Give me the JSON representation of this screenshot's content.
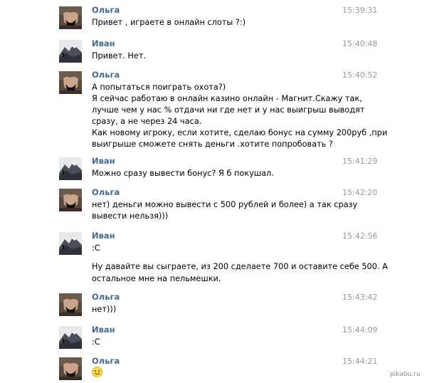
{
  "messages": [
    {
      "author": "Ольга",
      "time": "15:39:31",
      "lines": [
        "Привет , играете в онлайн слоты ?:)"
      ]
    },
    {
      "author": "Иван",
      "time": "15:40:48",
      "lines": [
        "Привет. Нет."
      ]
    },
    {
      "author": "Ольга",
      "time": "15:40:52",
      "lines": [
        "А попытаться поиграть охота?)",
        "Я сейчас работаю в онлайн казино онлайн - Магнит.Скажу так,",
        "лучше чем у нас % отдачи ни где нет и у нас выигрыш выводят",
        "сразу, а не через 24 часа.",
        "Как новому игроку, если хотите, сделаю бонус на сумму 200руб ,при",
        "выигрыше сможете снять деньги .хотите попробовать ?"
      ]
    },
    {
      "author": "Иван",
      "time": "15:41:29",
      "lines": [
        "Можно сразу вывести бонус? Я б покушал."
      ]
    },
    {
      "author": "Ольга",
      "time": "15:42:20",
      "lines": [
        "нет) деньги можно вывести с 500 рублей и более) а так сразу",
        "вывести нельзя)))"
      ]
    },
    {
      "author": "Иван",
      "time": "15:42:56",
      "lines": [
        ":С"
      ],
      "extra_lines": [
        "Ну давайте вы сыграете, из 200 сделаете 700 и оставите себе 500. А",
        "остальное мне на пельмешки."
      ]
    },
    {
      "author": "Ольга",
      "time": "15:43:42",
      "lines": [
        "нет)))"
      ]
    },
    {
      "author": "Иван",
      "time": "15:44:09",
      "lines": [
        ":С"
      ]
    },
    {
      "author": "Ольга",
      "time": "15:44:21",
      "lines": [],
      "emoji": "smiley-icon"
    }
  ],
  "watermark": "pikabu.ru",
  "colors": {
    "author": "#45688e",
    "time": "#999999",
    "text": "#000000"
  }
}
